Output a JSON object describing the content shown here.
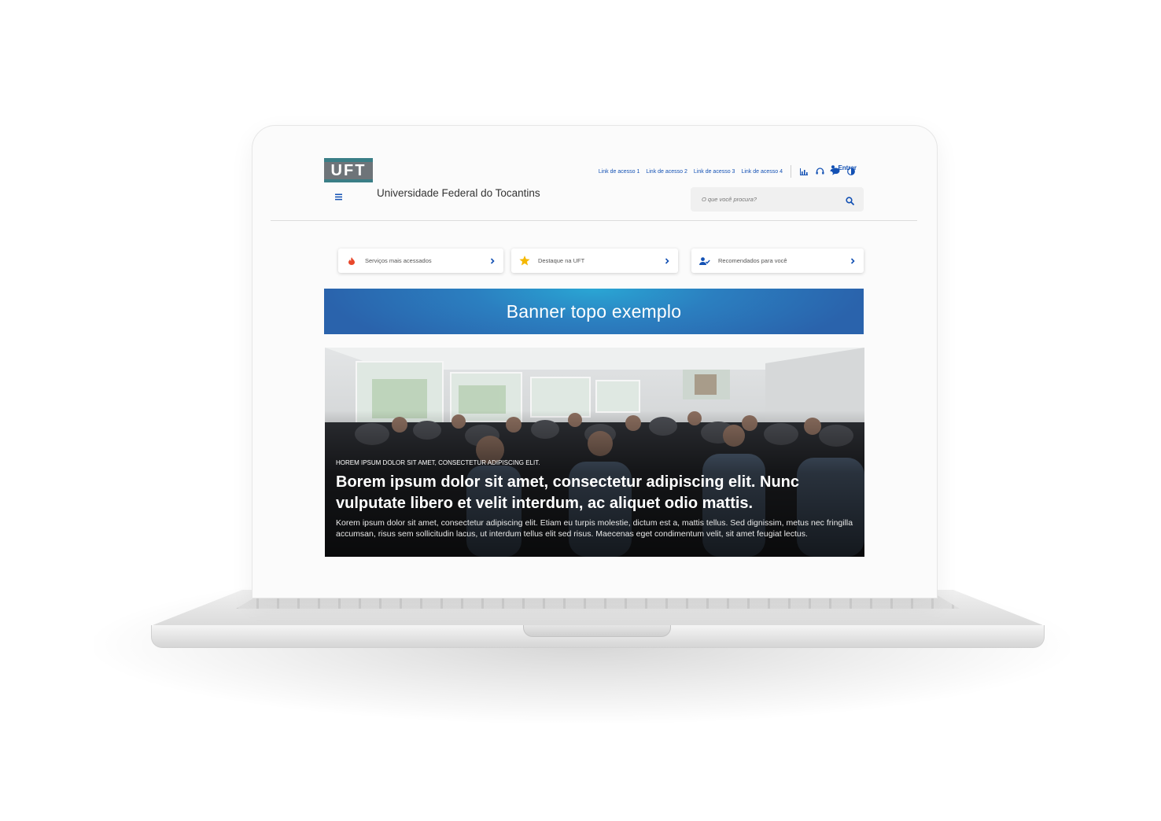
{
  "header": {
    "logo_text": "UFT",
    "site_title": "Universidade Federal do Tocantins",
    "links": [
      "Link de acesso 1",
      "Link de acesso 2",
      "Link de acesso 3",
      "Link de acesso 4"
    ],
    "icons": [
      "chart-icon",
      "headset-icon",
      "chat-bubble-icon",
      "contrast-icon"
    ],
    "login_label": "Entrar",
    "search_placeholder": "O que você procura?"
  },
  "quick_links": [
    {
      "label": "Serviços mais acessados",
      "icon": "fire-icon"
    },
    {
      "label": "Destaque na UFT",
      "icon": "star-icon"
    },
    {
      "label": "Recomendados para você",
      "icon": "user-check-icon"
    }
  ],
  "banner": {
    "text": "Banner topo exemplo"
  },
  "hero": {
    "kicker": "HOREM IPSUM DOLOR SIT AMET, CONSECTETUR ADIPISCING ELIT.",
    "headline": "Borem ipsum dolor sit amet, consectetur adipiscing elit. Nunc vulputate libero et velit interdum, ac aliquet odio mattis.",
    "description": "Korem ipsum dolor sit amet, consectetur adipiscing elit. Etiam eu turpis molestie, dictum est a, mattis tellus. Sed dignissim, metus nec fringilla accumsan, risus sem sollicitudin lacus, ut interdum tellus elit sed risus. Maecenas eget condimentum velit, sit amet feugiat lectus."
  },
  "colors": {
    "accent": "#1351b4",
    "logo_teal": "#3a7e86",
    "banner_blue": "#2a63ac",
    "fire": "#e8472b",
    "star": "#f5b800"
  }
}
